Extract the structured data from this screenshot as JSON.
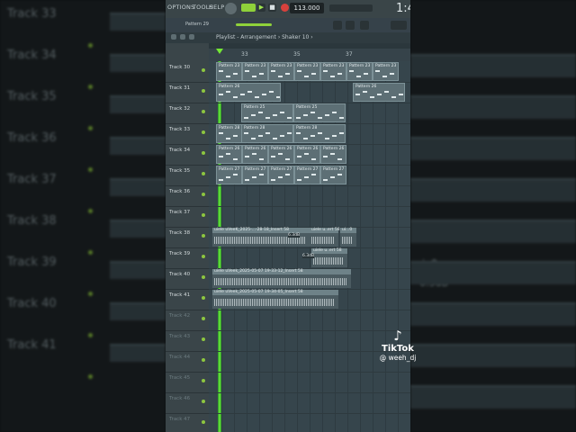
{
  "menu": {
    "items": [
      "OPTIONS",
      "TOOLS",
      "HELP"
    ],
    "pattern_selector": "Pattern 29"
  },
  "transport": {
    "tempo": "113.000",
    "time": "1:4"
  },
  "playlist": {
    "breadcrumb": "Playlist - Arrangement › Shaker 10 ›",
    "ruler": [
      "33",
      "35",
      "37"
    ],
    "tracks": [
      {
        "name": "Track 30",
        "clips": [
          {
            "label": "Pattern 23"
          },
          {
            "label": "Pattern 23"
          },
          {
            "label": "Pattern 23"
          },
          {
            "label": "Pattern 23"
          },
          {
            "label": "Pattern 23"
          },
          {
            "label": "Pattern 23"
          },
          {
            "label": "Pattern 23"
          }
        ]
      },
      {
        "name": "Track 31",
        "clips": [
          {
            "label": "Pattern 26"
          },
          {
            "label": "Pattern 26"
          }
        ]
      },
      {
        "name": "Track 32",
        "clips": [
          {
            "label": "Pattern 25"
          },
          {
            "label": "Pattern 25"
          }
        ]
      },
      {
        "name": "Track 33",
        "clips": [
          {
            "label": "Pattern 28"
          },
          {
            "label": "Pattern 28"
          },
          {
            "label": "Pattern 28"
          }
        ]
      },
      {
        "name": "Track 34",
        "clips": [
          {
            "label": "Pattern 26"
          },
          {
            "label": "Pattern 26"
          },
          {
            "label": "Pattern 26"
          },
          {
            "label": "Pattern 26"
          },
          {
            "label": "Pattern 26"
          }
        ]
      },
      {
        "name": "Track 35",
        "clips": [
          {
            "label": "Pattern 27"
          },
          {
            "label": "Pattern 27"
          },
          {
            "label": "Pattern 27"
          },
          {
            "label": "Pattern 27"
          },
          {
            "label": "Pattern 27"
          }
        ]
      },
      {
        "name": "Track 36",
        "clips": []
      },
      {
        "name": "Track 37",
        "clips": []
      },
      {
        "name": "Track 38",
        "clips": [
          {
            "label": "uiele uVeeK_2025-...-28-18_Insert 58"
          },
          {
            "label": "uiele u..ert 58"
          },
          {
            "label": "ui...0"
          }
        ]
      },
      {
        "name": "Track 39",
        "clips": [
          {
            "label": "uiele u..ert 58"
          }
        ]
      },
      {
        "name": "Track 40",
        "clips": [
          {
            "label": "uiele uVeek_2025-05-07 19-33-12_Insert 58"
          }
        ]
      },
      {
        "name": "Track 41",
        "clips": [
          {
            "label": "uiele uVeek_2025-05-07 19-34-05_Insert 58"
          }
        ]
      },
      {
        "name": "Track 42",
        "clips": []
      },
      {
        "name": "Track 43",
        "clips": []
      },
      {
        "name": "Track 44",
        "clips": []
      },
      {
        "name": "Track 45",
        "clips": []
      },
      {
        "name": "Track 46",
        "clips": []
      },
      {
        "name": "Track 47",
        "clips": []
      }
    ],
    "volume_labels": [
      "6.3dB",
      "6.3dB"
    ]
  },
  "background": {
    "left_tracks": [
      "Track 33",
      "Track 34",
      "Track 35",
      "Track 36",
      "Track 37",
      "Track 38",
      "Track 39",
      "Track 40",
      "Track 41"
    ],
    "right_labels": [
      "Pattern 26",
      "Pattern 27",
      "ui..0",
      "6.3dB"
    ]
  },
  "overlay": {
    "brand": "TikTok",
    "handle": "@ weeh_dj"
  },
  "colors": {
    "accent_green": "#6cf23d",
    "clip_fill": "#5d6f75",
    "lane_bg": "#36454c"
  }
}
